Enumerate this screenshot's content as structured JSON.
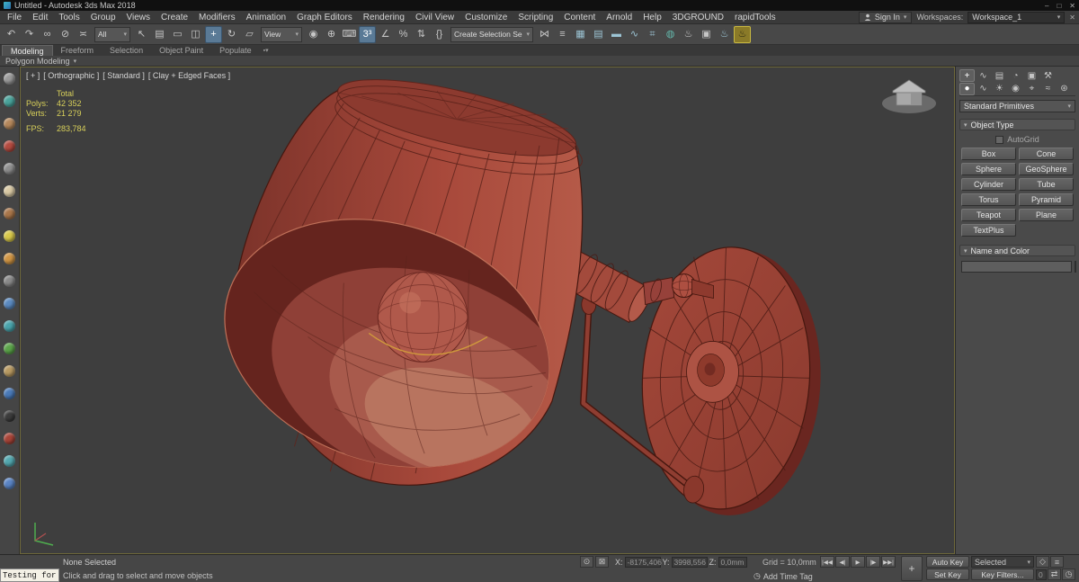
{
  "titlebar": {
    "title": "Untitled - Autodesk 3ds Max 2018",
    "minimize": "–",
    "maximize": "□",
    "close": "✕"
  },
  "menubar": {
    "items": [
      "File",
      "Edit",
      "Tools",
      "Group",
      "Views",
      "Create",
      "Modifiers",
      "Animation",
      "Graph Editors",
      "Rendering",
      "Civil View",
      "Customize",
      "Scripting",
      "Content",
      "Arnold",
      "Help",
      "3DGROUND",
      "rapidTools"
    ],
    "sign_in": "Sign In",
    "workspaces_label": "Workspaces:",
    "workspace_value": "Workspace_1",
    "close_glyph": "✕"
  },
  "toolbar": {
    "group1": [
      {
        "name": "undo-icon",
        "glyph": "↶"
      },
      {
        "name": "redo-icon",
        "glyph": "↷"
      },
      {
        "name": "select-and-link-icon",
        "glyph": "∞"
      },
      {
        "name": "unlink-selection-icon",
        "glyph": "⊘"
      },
      {
        "name": "bind-to-space-warp-icon",
        "glyph": "≍"
      }
    ],
    "filter_value": "All",
    "group2": [
      {
        "name": "select-object-icon",
        "glyph": "↖"
      },
      {
        "name": "select-by-name-icon",
        "glyph": "▤"
      },
      {
        "name": "rectangular-selection-region-icon",
        "glyph": "▭"
      },
      {
        "name": "window-crossing-icon",
        "glyph": "◫"
      },
      {
        "name": "select-and-move-icon",
        "glyph": "+",
        "active": true
      },
      {
        "name": "select-and-rotate-icon",
        "glyph": "↻"
      },
      {
        "name": "select-and-scale-icon",
        "glyph": "▱"
      }
    ],
    "coord_value": "View",
    "group3": [
      {
        "name": "use-pivot-point-icon",
        "glyph": "◉"
      },
      {
        "name": "select-and-manipulate-icon",
        "glyph": "⊕"
      },
      {
        "name": "keyboard-shortcut-override-icon",
        "glyph": "⌨"
      },
      {
        "name": "snaps-toggle-icon",
        "glyph": "3³",
        "active": true
      },
      {
        "name": "angle-snap-icon",
        "glyph": "∠"
      },
      {
        "name": "percent-snap-icon",
        "glyph": "%"
      },
      {
        "name": "spinner-snap-icon",
        "glyph": "⇅"
      },
      {
        "name": "named-selection-sets-icon",
        "glyph": "{}"
      }
    ],
    "named_selection_value": "Create Selection Se",
    "group4": [
      {
        "name": "mirror-icon",
        "glyph": "⋈"
      },
      {
        "name": "align-icon",
        "glyph": "≡"
      },
      {
        "name": "scene-explorer-icon",
        "glyph": "▦",
        "color": "#9cc4d4"
      },
      {
        "name": "layer-explorer-icon",
        "glyph": "▤",
        "color": "#9cc4d4"
      },
      {
        "name": "ribbon-toggle-icon",
        "glyph": "▬",
        "color": "#9cc4d4"
      },
      {
        "name": "curve-editor-icon",
        "glyph": "∿",
        "color": "#9cc4d4"
      },
      {
        "name": "schematic-view-icon",
        "glyph": "⌗",
        "color": "#9cc4d4"
      },
      {
        "name": "material-editor-icon",
        "glyph": "◍",
        "color": "#64b8ac"
      },
      {
        "name": "render-setup-icon",
        "glyph": "♨"
      },
      {
        "name": "rendered-frame-icon",
        "glyph": "▣"
      },
      {
        "name": "render-in-cloud-icon",
        "glyph": "♨",
        "color": "#9cc4d4"
      },
      {
        "name": "render-production-icon",
        "glyph": "♨",
        "color": "#2e2a10",
        "box": true
      }
    ]
  },
  "ribbon": {
    "tabs": [
      {
        "label": "Modeling",
        "active": true
      },
      {
        "label": "Freeform"
      },
      {
        "label": "Selection"
      },
      {
        "label": "Object Paint"
      },
      {
        "label": "Populate"
      }
    ],
    "extra_glyph": "▪▾",
    "section_label": "Polygon Modeling",
    "section_caret": "▾"
  },
  "left_toolbar": {
    "items": [
      {
        "name": "left-toolbar-icon",
        "color": "#9a9a9a"
      },
      {
        "name": "left-toolbar-icon",
        "color": "#4aa49c"
      },
      {
        "name": "left-toolbar-icon",
        "color": "#b5885c"
      },
      {
        "name": "left-toolbar-icon",
        "color": "#b44b40"
      },
      {
        "name": "left-toolbar-icon",
        "color": "#8f8f8f"
      },
      {
        "name": "left-toolbar-icon",
        "color": "#d9c9a4"
      },
      {
        "name": "left-toolbar-icon",
        "color": "#a9764a"
      },
      {
        "name": "left-toolbar-icon",
        "color": "#d8c84a"
      },
      {
        "name": "left-toolbar-icon",
        "color": "#d09544"
      },
      {
        "name": "left-toolbar-icon",
        "color": "#8a8a8a"
      },
      {
        "name": "left-toolbar-icon",
        "color": "#5b8ac0"
      },
      {
        "name": "left-toolbar-icon",
        "color": "#4aa4ac"
      },
      {
        "name": "left-toolbar-icon",
        "color": "#5ba44a"
      },
      {
        "name": "left-toolbar-icon",
        "color": "#b89a62"
      },
      {
        "name": "left-toolbar-icon",
        "color": "#4a7ab8"
      },
      {
        "name": "left-toolbar-icon",
        "color": "#3c3c3c"
      },
      {
        "name": "left-toolbar-icon",
        "color": "#a84438"
      },
      {
        "name": "left-toolbar-icon",
        "color": "#53a8b0"
      },
      {
        "name": "left-toolbar-icon",
        "color": "#5a84c4"
      }
    ]
  },
  "viewport": {
    "label_parts": [
      "[ + ]",
      "[ Orthographic ]",
      "[ Standard ]",
      "[ Clay + Edged Faces ]"
    ],
    "stats": {
      "total_label": "Total",
      "polys_label": "Polys:",
      "polys_value": "42 352",
      "verts_label": "Verts:",
      "verts_value": "21 279",
      "fps_label": "FPS:",
      "fps_value": "283,784"
    }
  },
  "command_panel": {
    "main_tabs": [
      {
        "name": "create-tab",
        "glyph": "+",
        "active": true
      },
      {
        "name": "modify-tab",
        "glyph": "∿"
      },
      {
        "name": "hierarchy-tab",
        "glyph": "▤"
      },
      {
        "name": "motion-tab",
        "glyph": "◔"
      },
      {
        "name": "display-tab",
        "glyph": "▣"
      },
      {
        "name": "utilities-tab",
        "glyph": "⚒"
      }
    ],
    "category_tabs": [
      {
        "name": "geometry-category",
        "glyph": "●",
        "active": true
      },
      {
        "name": "shapes-category",
        "glyph": "∿"
      },
      {
        "name": "lights-category",
        "glyph": "☀"
      },
      {
        "name": "cameras-category",
        "glyph": "◉"
      },
      {
        "name": "helpers-category",
        "glyph": "⌖"
      },
      {
        "name": "space-warps-category",
        "glyph": "≈"
      },
      {
        "name": "systems-category",
        "glyph": "⊛"
      }
    ],
    "primitives_dropdown": "Standard Primitives",
    "dropdown_caret": "▾",
    "object_type_title": "Object Type",
    "autogrid_label": "AutoGrid",
    "object_buttons": [
      "Box",
      "Cone",
      "Sphere",
      "GeoSphere",
      "Cylinder",
      "Tube",
      "Torus",
      "Pyramid",
      "Teapot",
      "Plane",
      "TextPlus"
    ],
    "name_color_title": "Name and Color"
  },
  "status_bar": {
    "selection_text": "None Selected",
    "prompt_text": "Click and drag to select and move objects",
    "isolate_glyph": "⊙",
    "lock_glyph": "⊠",
    "x_label": "X:",
    "x_value": "-8175,406",
    "y_label": "Y:",
    "y_value": "3998,556",
    "z_label": "Z:",
    "z_value": "0,0mm",
    "grid_text": "Grid = 10,0mm",
    "clock_glyph": "◷",
    "add_time_tag": "Add Time Tag",
    "playback": [
      {
        "name": "go-to-start-button",
        "glyph": "|◀◀"
      },
      {
        "name": "previous-frame-button",
        "glyph": "◀|"
      },
      {
        "name": "play-button",
        "glyph": "▶"
      },
      {
        "name": "next-frame-button",
        "glyph": "|▶"
      },
      {
        "name": "go-to-end-button",
        "glyph": "▶▶|"
      }
    ],
    "set_keys_glyph": "+",
    "auto_key": "Auto Key",
    "set_key": "Set Key",
    "selected_dropdown": "Selected",
    "key_filters": "Key Filters...",
    "frame_value": "0",
    "right_icons1": [
      {
        "name": "status-icon",
        "glyph": "◇"
      },
      {
        "name": "status-icon",
        "glyph": "≡"
      }
    ],
    "right_icons2": [
      {
        "name": "status-icon",
        "glyph": "⇄"
      },
      {
        "name": "status-icon",
        "glyph": "◷"
      }
    ]
  },
  "listener": {
    "text": "Testing for"
  }
}
